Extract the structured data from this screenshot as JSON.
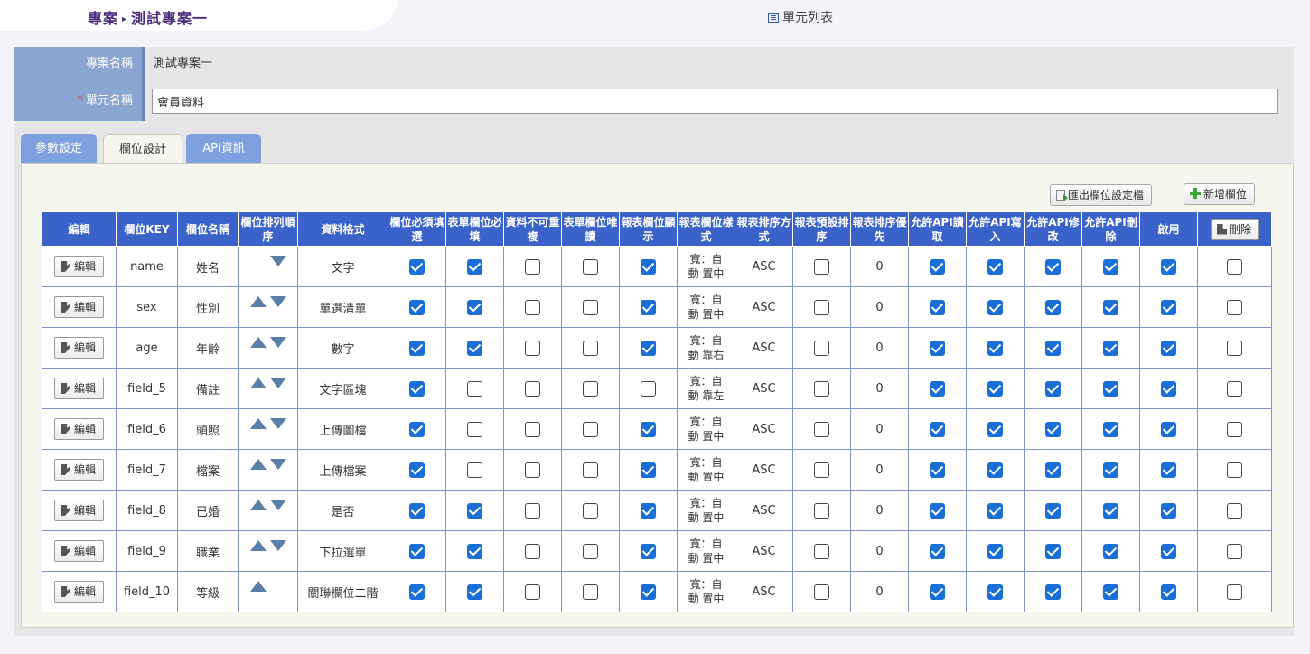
{
  "breadcrumb": {
    "section": "專案",
    "project": "測試專案一"
  },
  "unit_list_link": "單元列表",
  "form": {
    "project_name_label": "專案名稱",
    "project_name_value": "測試專案一",
    "unit_name_required": "*",
    "unit_name_label": "單元名稱",
    "unit_name_value": "會員資料"
  },
  "tabs": [
    {
      "label": "參數設定",
      "active": false
    },
    {
      "label": "欄位設計",
      "active": true
    },
    {
      "label": "API資訊",
      "active": false
    }
  ],
  "toolbar": {
    "export_label": "匯出欄位設定檔",
    "add_label": "新增欄位"
  },
  "table": {
    "headers": [
      "編輯",
      "欄位KEY",
      "欄位名稱",
      "欄位排列順序",
      "資料格式",
      "欄位必須填選",
      "表單欄位必填",
      "資料不可重複",
      "表單欄位唯讀",
      "報表欄位顯示",
      "報表欄位樣式",
      "報表排序方式",
      "報表預設排序",
      "報表排序優先",
      "允許API讀取",
      "允許API寫入",
      "允許API修改",
      "允許API刪除",
      "啟用"
    ],
    "delete_label": "刪除",
    "edit_label": "編輯",
    "rows": [
      {
        "key": "name",
        "name": "姓名",
        "up": false,
        "down": true,
        "format": "文字",
        "style": "寬：自動 置中",
        "sort": "ASC",
        "priority": "0",
        "checks": [
          true,
          true,
          false,
          false,
          true
        ],
        "defaultSort": false,
        "api": [
          true,
          true,
          true,
          true
        ],
        "enabled": true,
        "delete": false
      },
      {
        "key": "sex",
        "name": "性別",
        "up": true,
        "down": true,
        "format": "單選清單",
        "style": "寬：自動 置中",
        "sort": "ASC",
        "priority": "0",
        "checks": [
          true,
          true,
          false,
          false,
          true
        ],
        "defaultSort": false,
        "api": [
          true,
          true,
          true,
          true
        ],
        "enabled": true,
        "delete": false
      },
      {
        "key": "age",
        "name": "年齡",
        "up": true,
        "down": true,
        "format": "數字",
        "style": "寬：自動 靠右",
        "sort": "ASC",
        "priority": "0",
        "checks": [
          true,
          true,
          false,
          false,
          true
        ],
        "defaultSort": false,
        "api": [
          true,
          true,
          true,
          true
        ],
        "enabled": true,
        "delete": false
      },
      {
        "key": "field_5",
        "name": "備註",
        "up": true,
        "down": true,
        "format": "文字區塊",
        "style": "寬：自動 靠左",
        "sort": "ASC",
        "priority": "0",
        "checks": [
          true,
          false,
          false,
          false,
          false
        ],
        "defaultSort": false,
        "api": [
          true,
          true,
          true,
          true
        ],
        "enabled": true,
        "delete": false
      },
      {
        "key": "field_6",
        "name": "頭照",
        "up": true,
        "down": true,
        "format": "上傳圖檔",
        "style": "寬：自動 置中",
        "sort": "ASC",
        "priority": "0",
        "checks": [
          true,
          false,
          false,
          false,
          true
        ],
        "defaultSort": false,
        "api": [
          true,
          true,
          true,
          true
        ],
        "enabled": true,
        "delete": false
      },
      {
        "key": "field_7",
        "name": "檔案",
        "up": true,
        "down": true,
        "format": "上傳檔案",
        "style": "寬：自動 置中",
        "sort": "ASC",
        "priority": "0",
        "checks": [
          true,
          false,
          false,
          false,
          true
        ],
        "defaultSort": false,
        "api": [
          true,
          true,
          true,
          true
        ],
        "enabled": true,
        "delete": false
      },
      {
        "key": "field_8",
        "name": "已婚",
        "up": true,
        "down": true,
        "format": "是否",
        "style": "寬：自動 置中",
        "sort": "ASC",
        "priority": "0",
        "checks": [
          true,
          true,
          false,
          false,
          true
        ],
        "defaultSort": false,
        "api": [
          true,
          true,
          true,
          true
        ],
        "enabled": true,
        "delete": false
      },
      {
        "key": "field_9",
        "name": "職業",
        "up": true,
        "down": true,
        "format": "下拉選單",
        "style": "寬：自動 置中",
        "sort": "ASC",
        "priority": "0",
        "checks": [
          true,
          true,
          false,
          false,
          true
        ],
        "defaultSort": false,
        "api": [
          true,
          true,
          true,
          true
        ],
        "enabled": true,
        "delete": false
      },
      {
        "key": "field_10",
        "name": "等級",
        "up": true,
        "down": false,
        "format": "關聯欄位二階",
        "style": "寬：自動 置中",
        "sort": "ASC",
        "priority": "0",
        "checks": [
          true,
          true,
          false,
          false,
          true
        ],
        "defaultSort": false,
        "api": [
          true,
          true,
          true,
          true
        ],
        "enabled": true,
        "delete": false
      }
    ]
  },
  "colors": {
    "header_blue": "#3b62c9",
    "tab_blue": "#7ea0de",
    "label_blue": "#8aa5d0",
    "check_blue": "#1a6fd6",
    "breadcrumb_purple": "#4a2a7a"
  }
}
